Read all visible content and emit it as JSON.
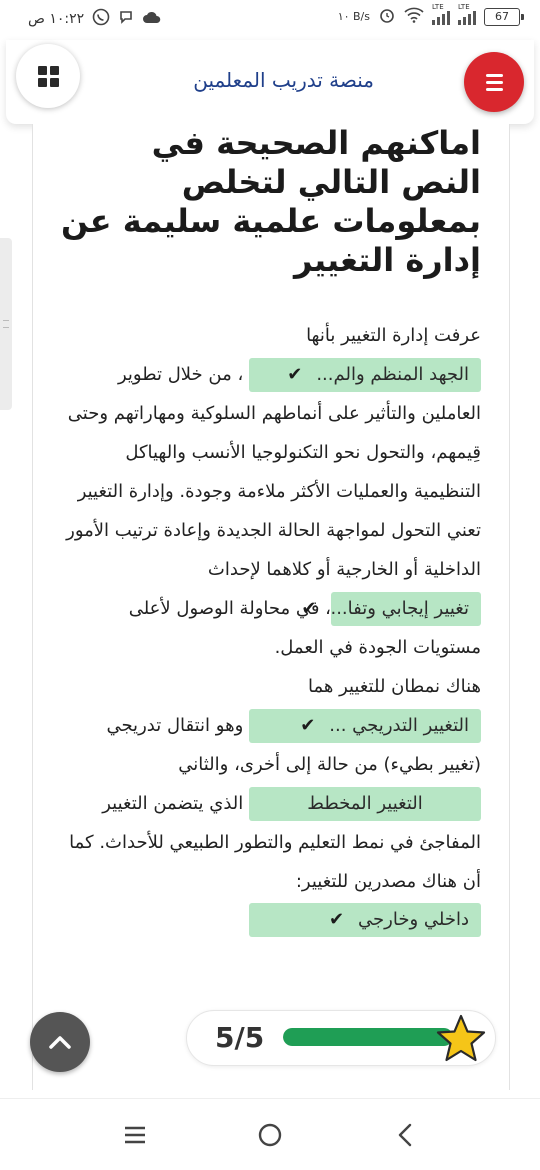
{
  "status_bar": {
    "time": "١٠:٢٢ ص",
    "net_speed": "١٠ B/s",
    "battery": "67",
    "lte1": "LTE",
    "lte2": "LTE"
  },
  "header": {
    "site_title": "منصة تدريب المعلمين"
  },
  "article": {
    "heading": "اماكنهم الصحيحة في النص التالي لتخلص بمعلومات علمية سليمة عن إدارة التغيير",
    "p1_intro": "عرفت إدارة التغيير بأنها",
    "p1_after_chip": "، من خلال تطوير",
    "p1_rest": "العاملين والتأثير على أنماطهم السلوكية ومهاراتهم وحتى قِيمهم، والتحول نحو التكنولوجيا الأنسب والهياكل التنظيمية والعمليات الأكثر ملاءمة وجودة. وإدارة التغيير تعني التحول لمواجهة الحالة الجديدة وإعادة ترتيب الأمور الداخلية أو الخارجية أو كلاهما لإحداث",
    "p2_after_chip": "، في محاولة الوصول لأعلى مستويات الجودة في العمل.",
    "p3_intro": "هناك نمطان للتغيير هما",
    "p3_after_chip1": "وهو انتقال تدريجي (تغيير بطيء) من حالة إلى أخرى، والثاني",
    "p3_after_chip2": "الذي يتضمن التغيير المفاجئ في نمط التعليم والتطور الطبيعي للأحداث. كما أن هناك مصدرين للتغيير:"
  },
  "answers": {
    "chip1": "الجهد المنظم والم...",
    "chip2": "تغيير إيجابي وتفا...",
    "chip3": "التغيير التدريجي ...",
    "chip4": "التغيير المخطط",
    "chip5": "داخلي وخارجي"
  },
  "score": {
    "text": "5/5",
    "progress": 1.0
  },
  "colors": {
    "accent_red": "#d9272e",
    "chip_green": "#b7e6c5",
    "progress_green": "#1f9e55",
    "title_blue": "#1f3f8a"
  },
  "icons": {
    "menu": "hamburger-icon",
    "grid": "grid-icon",
    "check": "check-icon",
    "star": "star-icon",
    "up": "chevron-up-icon"
  }
}
